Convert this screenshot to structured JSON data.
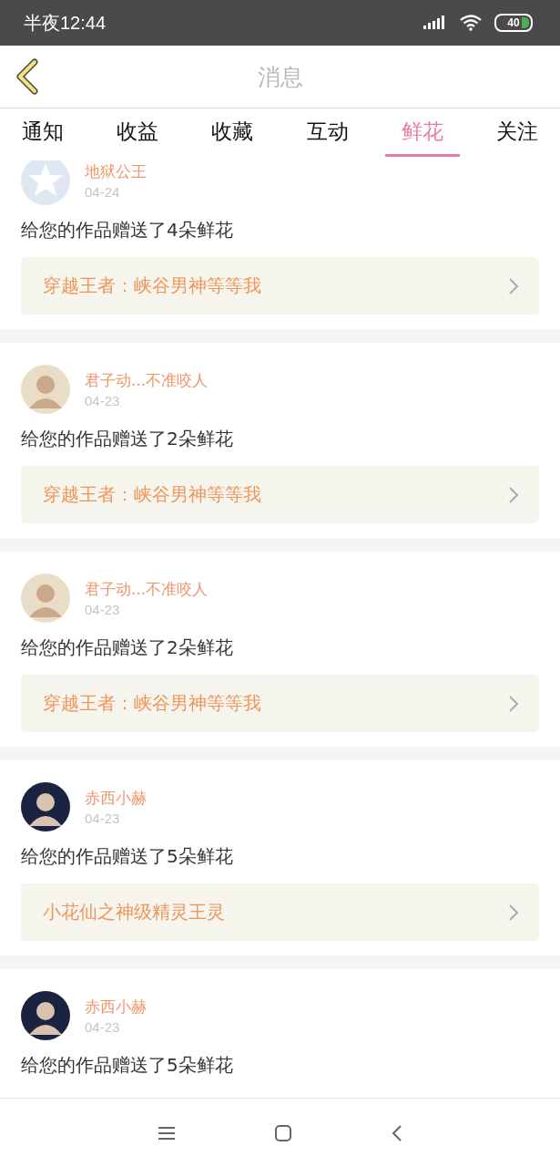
{
  "status_bar": {
    "time": "半夜12:44",
    "battery": "40"
  },
  "header": {
    "title": "消息"
  },
  "tabs": [
    {
      "label": "通知",
      "selected": false
    },
    {
      "label": "收益",
      "selected": false
    },
    {
      "label": "收藏",
      "selected": false
    },
    {
      "label": "互动",
      "selected": false
    },
    {
      "label": "鲜花",
      "selected": true
    },
    {
      "label": "关注",
      "selected": false
    }
  ],
  "messages": [
    {
      "name": "地狱公王",
      "date": "04-24",
      "kind": "default",
      "text": "给您的作品赠送了4朵鲜花",
      "work": "穿越王者：峡谷男神等等我"
    },
    {
      "name": "君子动...不准咬人",
      "date": "04-23",
      "kind": "photo",
      "text": "给您的作品赠送了2朵鲜花",
      "work": "穿越王者：峡谷男神等等我"
    },
    {
      "name": "君子动...不准咬人",
      "date": "04-23",
      "kind": "photo",
      "text": "给您的作品赠送了2朵鲜花",
      "work": "穿越王者：峡谷男神等等我"
    },
    {
      "name": "赤西小赫",
      "date": "04-23",
      "kind": "dark",
      "text": "给您的作品赠送了5朵鲜花",
      "work": "小花仙之神级精灵王灵"
    },
    {
      "name": "赤西小赫",
      "date": "04-23",
      "kind": "dark",
      "text": "给您的作品赠送了5朵鲜花"
    }
  ]
}
